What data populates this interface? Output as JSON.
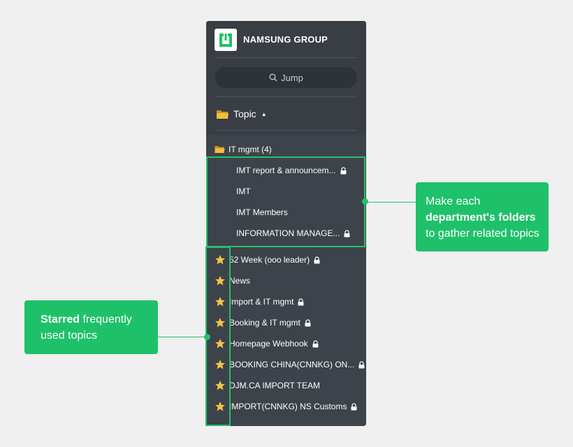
{
  "org": {
    "name": "NAMSUNG GROUP",
    "logo_icon": "jandi-logo-icon"
  },
  "jump": {
    "label": "Jump",
    "icon": "search-icon"
  },
  "topic_header": {
    "label": "Topic",
    "caret": "▲",
    "icon": "folder-icon"
  },
  "folder": {
    "label": "IT mgmt (4)",
    "icon": "folder-icon",
    "items": [
      {
        "label": "IMT report & announcem...",
        "locked": true
      },
      {
        "label": "IMT",
        "locked": false
      },
      {
        "label": "IMT Members",
        "locked": false
      },
      {
        "label": "INFORMATION MANAGE...",
        "locked": true
      }
    ]
  },
  "starred": [
    {
      "label": "52 Week (ooo leader)",
      "locked": true
    },
    {
      "label": "News",
      "locked": false
    },
    {
      "label": "Import & IT mgmt",
      "locked": true
    },
    {
      "label": "Booking & IT mgmt",
      "locked": true
    },
    {
      "label": "Homepage Webhook",
      "locked": true
    },
    {
      "label": "BOOKING CHINA(CNNKG) ON...",
      "locked": true
    },
    {
      "label": "DJM.CA IMPORT TEAM",
      "locked": false
    },
    {
      "label": "IMPORT(CNNKG) NS Customs",
      "locked": true
    }
  ],
  "callouts": {
    "folders": {
      "line1": "Make each",
      "line2_bold": "department's folders",
      "line3": "to gather related topics"
    },
    "starred": {
      "bold": "Starred",
      "line1_rest": " frequently",
      "line2": "used topics"
    }
  },
  "colors": {
    "accent": "#1ec169",
    "sidebar_bg": "#3d434a",
    "star": "#f5c344",
    "folder": "#f2c038",
    "page_bg": "#f0f0f0"
  }
}
